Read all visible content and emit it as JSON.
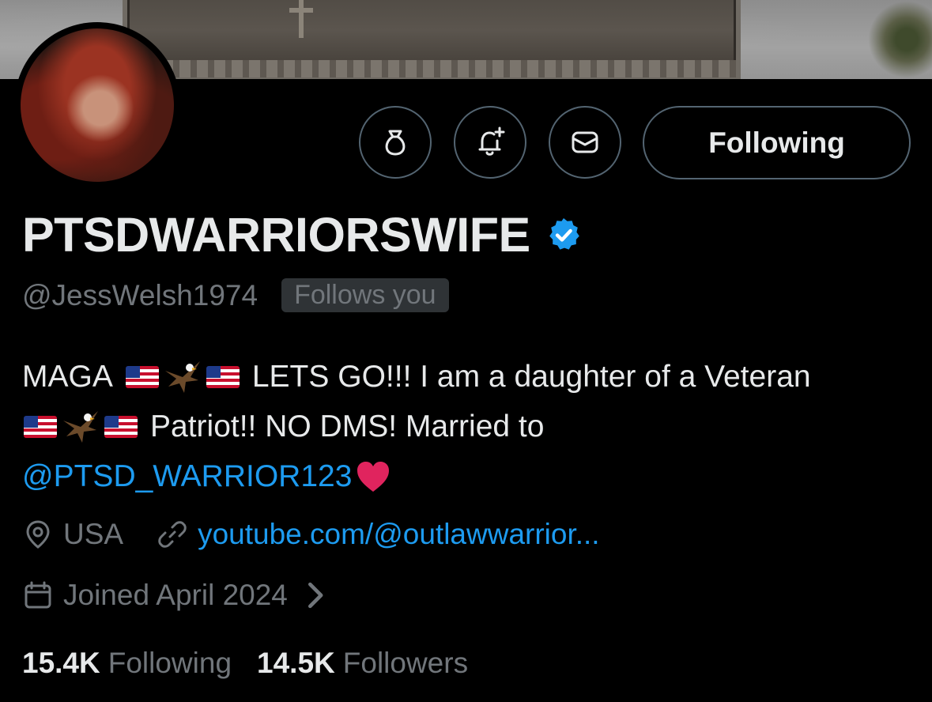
{
  "profile": {
    "display_name": "PTSDWARRIORSWIFE",
    "handle": "@JessWelsh1974",
    "follows_you": "Follows you",
    "verified": true
  },
  "actions": {
    "following_label": "Following",
    "icons": [
      "money-bag-icon",
      "notification-add-icon",
      "message-icon"
    ]
  },
  "bio": {
    "line1_start": "MAGA",
    "line1_end": "LETS GO!!! I am a daughter of a Veteran",
    "line2_text": "Patriot!! NO DMS! Married to",
    "mention": "@PTSD_WARRIOR123"
  },
  "meta": {
    "location": "USA",
    "website": "youtube.com/@outlawwarrior...",
    "joined": "Joined April 2024"
  },
  "stats": {
    "following_count": "15.4K",
    "following_label": "Following",
    "followers_count": "14.5K",
    "followers_label": "Followers"
  },
  "colors": {
    "background": "#000000",
    "text_primary": "#e7e9ea",
    "text_secondary": "#71767b",
    "link": "#1d9bf0",
    "border": "#536471",
    "verified_badge": "#1d9bf0"
  }
}
